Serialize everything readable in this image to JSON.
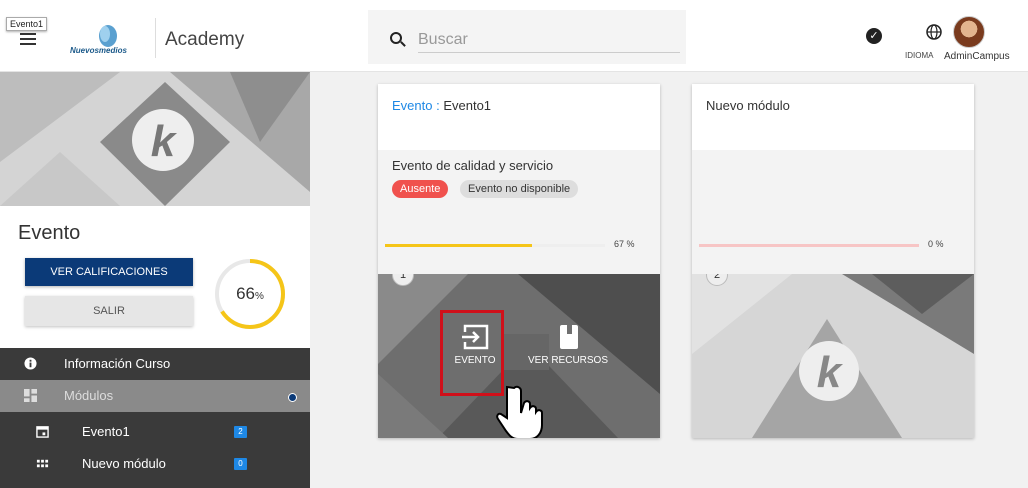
{
  "header": {
    "tooltip": "Evento1",
    "logo_text": "Nuevosmedios",
    "app_title": "Academy",
    "search_placeholder": "Buscar",
    "language_label": "IDIOMA",
    "user_name": "AdminCampus"
  },
  "sidebar": {
    "course_title": "Evento",
    "grades_button": "VER CALIFICACIONES",
    "exit_button": "SALIR",
    "progress": {
      "value": "66",
      "unit": "%",
      "fraction": 0.66
    },
    "nav": [
      {
        "label": "Información Curso",
        "icon": "info-icon"
      },
      {
        "label": "Módulos",
        "icon": "modules-icon"
      },
      {
        "label": "Evento1",
        "icon": "calendar-icon",
        "count": "2"
      },
      {
        "label": "Nuevo módulo",
        "icon": "grid-icon",
        "count": "0"
      }
    ]
  },
  "cards": [
    {
      "type_label": "Evento :",
      "title": "Evento1",
      "description": "Evento de calidad y servicio",
      "tags": [
        "Ausente",
        "Evento no disponible"
      ],
      "progress_label": "67 %",
      "progress_fraction": 0.67,
      "progress_color": "#f5c518",
      "number": "1",
      "actions": [
        "EVENTO",
        "VER RECURSOS"
      ]
    },
    {
      "title": "Nuevo módulo",
      "progress_label": "0 %",
      "progress_fraction": 0,
      "progress_color": "#f7c5c5",
      "number": "2"
    }
  ],
  "colors": {
    "primary_button": "#0b3a78",
    "accent_blue": "#1e88e5",
    "absent_tag": "#f0514d",
    "progress_yellow": "#f5c518",
    "highlight_red": "#d0101a"
  }
}
